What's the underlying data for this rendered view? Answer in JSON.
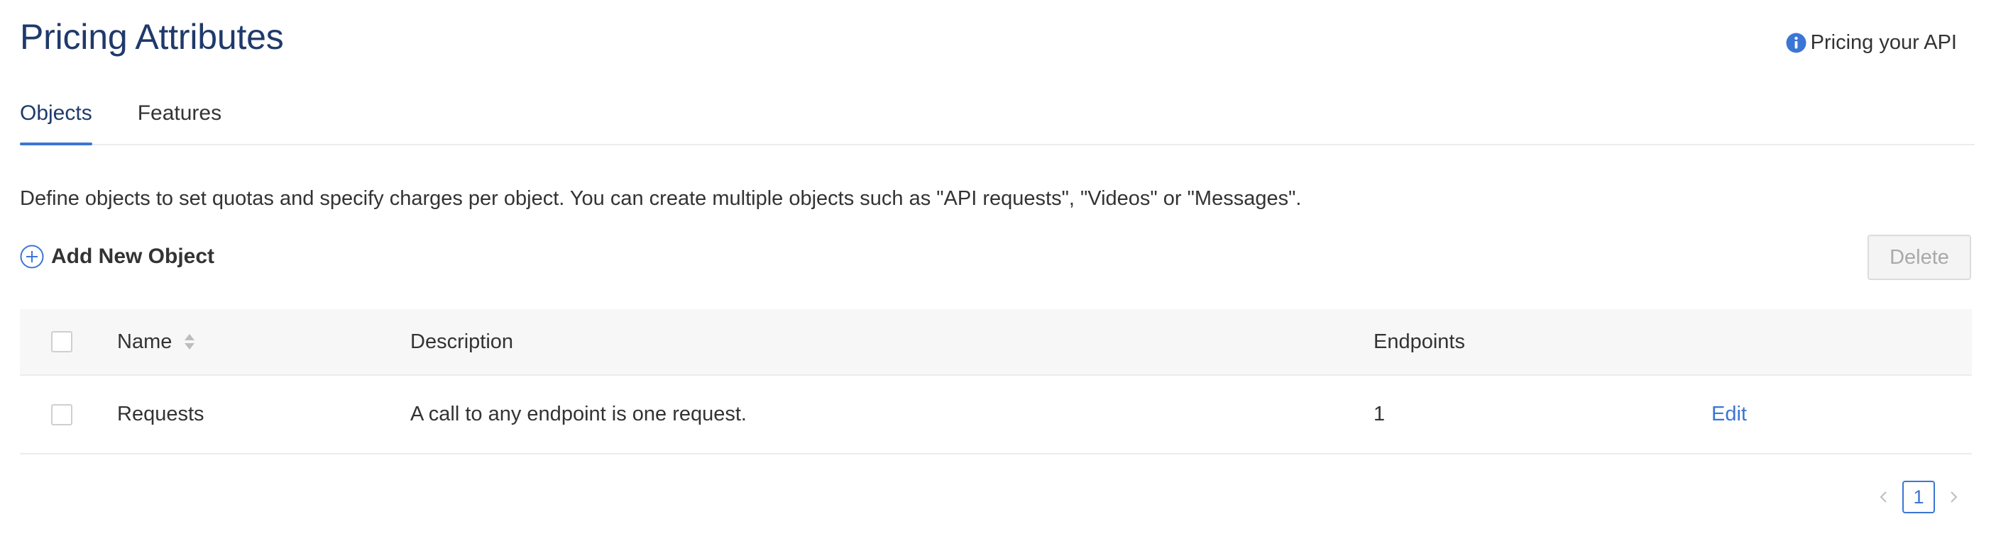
{
  "header": {
    "title": "Pricing Attributes",
    "help_link": "Pricing your API"
  },
  "tabs": [
    {
      "label": "Objects",
      "active": true
    },
    {
      "label": "Features",
      "active": false
    }
  ],
  "intro": "Define objects to set quotas and specify charges per object. You can create multiple objects such as \"API requests\", \"Videos\" or \"Messages\".",
  "actions": {
    "add_label": "Add New Object",
    "delete_label": "Delete"
  },
  "table": {
    "columns": [
      "Name",
      "Description",
      "Endpoints"
    ],
    "rows": [
      {
        "name": "Requests",
        "description": "A call to any endpoint is one request.",
        "endpoints": "1",
        "action": "Edit"
      }
    ]
  },
  "pagination": {
    "current_page": "1"
  },
  "colors": {
    "title": "#1f3a6b",
    "accent": "#3b76d4",
    "header_bg": "#f7f7f7",
    "border": "#ececec"
  },
  "icons": {
    "help": "info-icon",
    "add": "plus-circle-icon",
    "sort": "sort-icon",
    "prev": "chevron-left-icon",
    "next": "chevron-right-icon"
  }
}
